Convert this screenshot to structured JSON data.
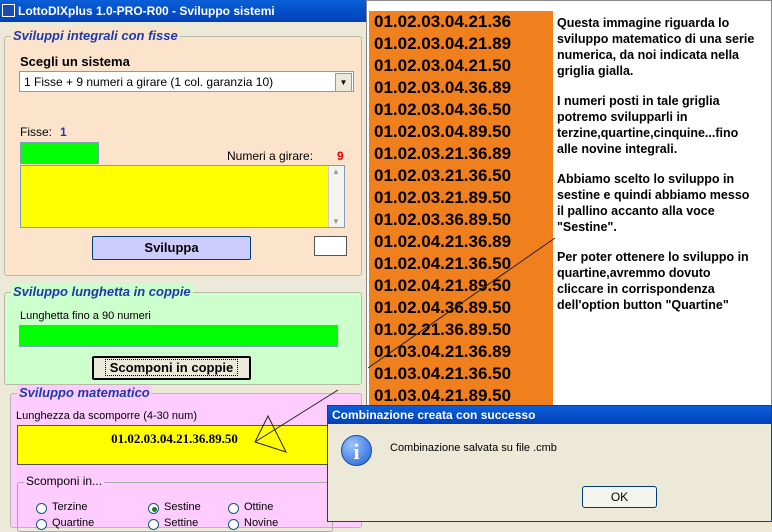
{
  "window": {
    "title": "LottoDIXplus 1.0-PRO-R00 - Sviluppo sistemi"
  },
  "group_integrali": {
    "legend": "Sviluppi integrali con fisse",
    "choose_label": "Scegli un sistema",
    "system_value": "1 Fisse + 9 numeri a girare (1 col. garanzia 10)",
    "fisse_label": "Fisse:",
    "fisse_value": "1",
    "girare_label": "Numeri a girare:",
    "girare_value": "9",
    "sviluppa_button": "Sviluppa"
  },
  "group_lunghetta": {
    "legend": "Sviluppo lunghetta in coppie",
    "label": "Lunghetta fino a 90 numeri",
    "button": "Scomponi in coppie"
  },
  "group_matematico": {
    "legend": "Sviluppo matematico",
    "label": "Lunghezza da scomporre (4-30 num)",
    "value": "01.02.03.04.21.36.89.50",
    "sub_legend": "Scomponi in...",
    "options": [
      "Terzine",
      "Sestine",
      "Ottine",
      "Quartine",
      "Settine",
      "Novine"
    ],
    "selected": "Sestine"
  },
  "results": [
    "01.02.03.04.21.36",
    "01.02.03.04.21.89",
    "01.02.03.04.21.50",
    "01.02.03.04.36.89",
    "01.02.03.04.36.50",
    "01.02.03.04.89.50",
    "01.02.03.21.36.89",
    "01.02.03.21.36.50",
    "01.02.03.21.89.50",
    "01.02.03.36.89.50",
    "01.02.04.21.36.89",
    "01.02.04.21.36.50",
    "01.02.04.21.89.50",
    "01.02.04.36.89.50",
    "01.02.21.36.89.50",
    "01.03.04.21.36.89",
    "01.03.04.21.36.50",
    "01.03.04.21.89.50"
  ],
  "explanation": [
    "Questa immagine riguarda lo sviluppo matematico di una serie numerica, da noi indicata nella griglia gialla.",
    "I numeri posti in tale griglia potremo svilupparli in terzine,quartine,cinquine...fino alle novine integrali.",
    "Abbiamo scelto lo sviluppo in sestine e quindi abbiamo messo il pallino accanto alla voce \"Sestine\".",
    "Per poter ottenere lo sviluppo in quartine,avremmo dovuto cliccare in corrispondenza dell'option button \"Quartine\""
  ],
  "dialog": {
    "title": "Combinazione creata con successo",
    "message": "Combinazione salvata su file .cmb",
    "ok": "OK"
  },
  "colors": {
    "orange": "#f07f1e",
    "yellow": "#ffff00",
    "green": "#00ff00",
    "peach": "#fbe3cc",
    "mint": "#ccffcc",
    "pink": "#ffccff"
  }
}
